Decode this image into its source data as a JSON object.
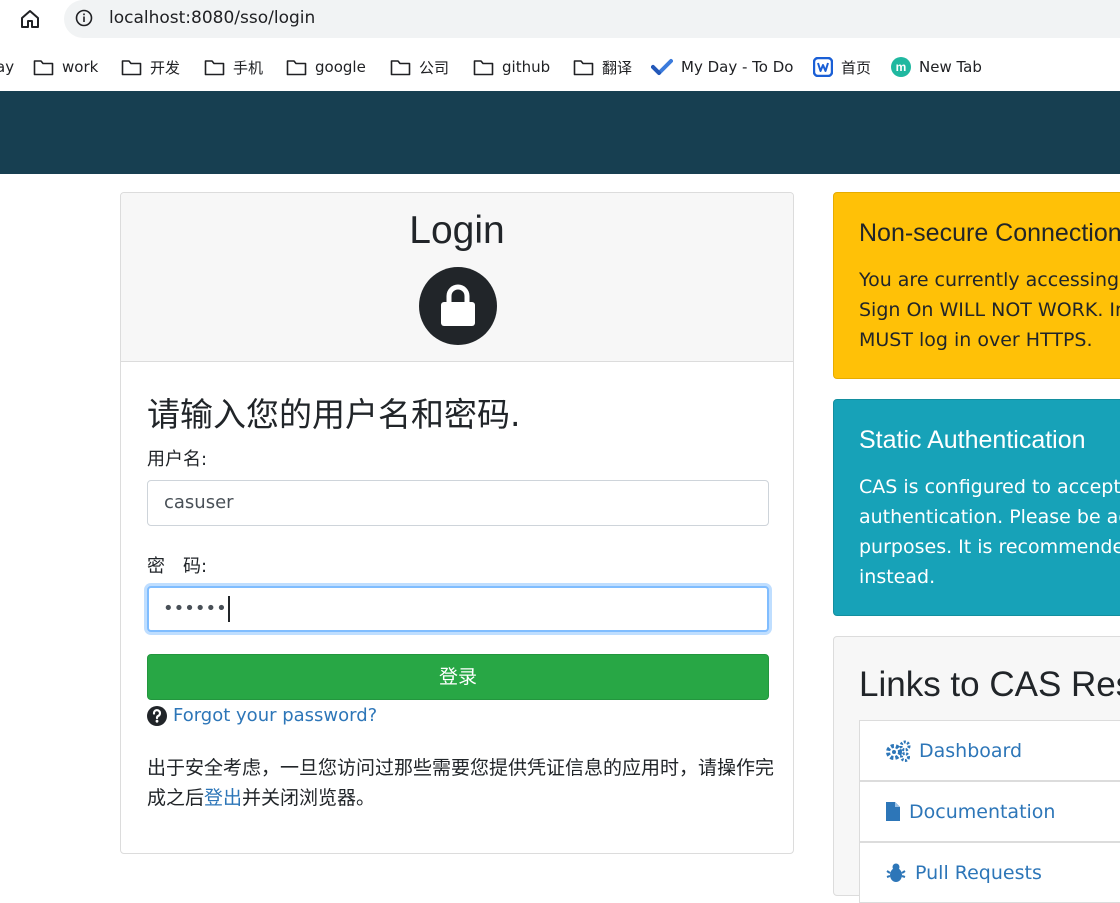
{
  "browser": {
    "url": "localhost:8080/sso/login",
    "bookmarks": [
      {
        "label": "ay",
        "icon": "none"
      },
      {
        "label": "work",
        "icon": "folder-icon"
      },
      {
        "label": "开发",
        "icon": "folder-icon"
      },
      {
        "label": "手机",
        "icon": "folder-icon"
      },
      {
        "label": "google",
        "icon": "folder-icon"
      },
      {
        "label": "公司",
        "icon": "folder-icon"
      },
      {
        "label": "github",
        "icon": "folder-icon"
      },
      {
        "label": "翻译",
        "icon": "folder-icon"
      },
      {
        "label": "My Day - To Do",
        "icon": "todo-check-icon"
      },
      {
        "label": "首页",
        "icon": "w-logo-icon"
      },
      {
        "label": "New Tab",
        "icon": "m-logo-icon"
      }
    ]
  },
  "login": {
    "title": "Login",
    "prompt": "请输入您的用户名和密码.",
    "username_label": "用户名:",
    "username_value": "casuser",
    "password_label": "密　码:",
    "password_value": "••••••",
    "submit_label": "登录",
    "forgot_label": "Forgot your password?",
    "notice_before": "出于安全考虑，一旦您访问过那些需要您提供凭证信息的应用时，请操作完成之后",
    "notice_link": "登出",
    "notice_after": "并关闭浏览器。"
  },
  "sidebar": {
    "warning": {
      "title": "Non-secure Connection",
      "lines": [
        "You are currently accessing CA",
        "Sign On WILL NOT WORK. In",
        "MUST log in over HTTPS."
      ]
    },
    "static_auth": {
      "title": "Static Authentication",
      "lines": [
        "CAS is configured to accept a",
        "authentication. Please be advi",
        "purposes. It is recommended",
        "instead."
      ]
    },
    "links": {
      "title": "Links to CAS Res",
      "items": [
        {
          "label": "Dashboard",
          "icon": "gears-icon"
        },
        {
          "label": "Documentation",
          "icon": "file-icon"
        },
        {
          "label": "Pull Requests",
          "icon": "bug-icon"
        }
      ]
    }
  },
  "colors": {
    "navbar": "#173f51",
    "warning": "#ffc107",
    "info": "#17a2b8",
    "success": "#28a745",
    "link": "#2d76b8"
  }
}
